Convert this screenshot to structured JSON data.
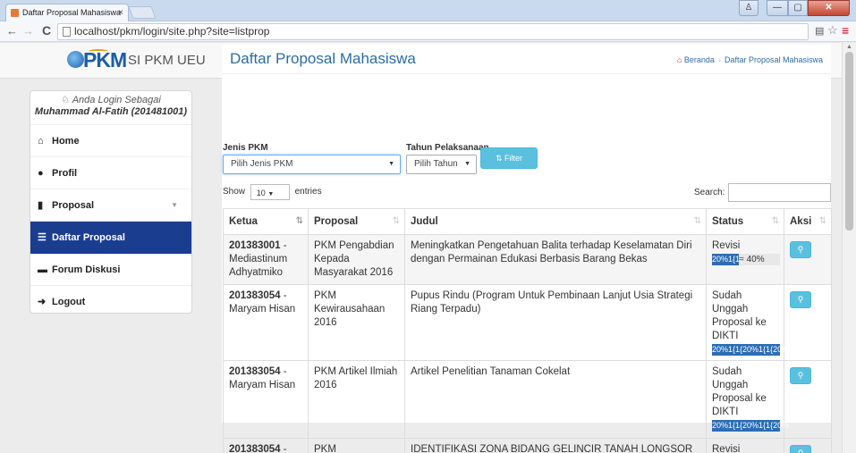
{
  "browser": {
    "tab_title": "Daftar Proposal Mahasiswa",
    "tab_close": "×",
    "url": "localhost/pkm/login/site.php?site=listprop"
  },
  "navbar": {
    "logo_text": "PKM",
    "brand": "SI PKM UEU"
  },
  "sidebar": {
    "login_label": "Anda Login Sebagai",
    "login_name": "Muhammad Al-Fatih (201481001)",
    "items": [
      {
        "label": "Home",
        "icon": "home-icon"
      },
      {
        "label": "Profil",
        "icon": "user-icon"
      },
      {
        "label": "Proposal",
        "icon": "book-icon"
      },
      {
        "label": "Daftar Proposal",
        "icon": "list-icon"
      },
      {
        "label": "Forum Diskusi",
        "icon": "comment-icon"
      },
      {
        "label": "Logout",
        "icon": "logout-icon"
      }
    ]
  },
  "header": {
    "title": "Daftar Proposal Mahasiswa",
    "breadcrumb_home": "Beranda",
    "breadcrumb_current": "Daftar Proposal Mahasiswa"
  },
  "filters": {
    "jenis_label": "Jenis PKM",
    "jenis_value": "Pilih Jenis PKM",
    "tahun_label": "Tahun Pelaksanaan",
    "tahun_value": "Pilih Tahun",
    "filter_button": "Filter"
  },
  "table_controls": {
    "show_label": "Show",
    "entries_value": "10",
    "entries_label": "entries",
    "search_label": "Search:"
  },
  "table": {
    "columns": [
      "Ketua",
      "Proposal",
      "Judul",
      "Status",
      "Aksi"
    ],
    "rows": [
      {
        "ketua_id": "201383001",
        "ketua_name": " - Mediastinum Adhyatmiko",
        "proposal": "PKM Pengabdian Kepada Masyarakat 2016",
        "judul": "Meningkatkan Pengetahuan Balita terhadap Keselamatan Diri dengan Permainan Edukasi Berbasis Barang Bekas",
        "status": "Revisi",
        "progress_text": "20%1{1{",
        "progress_suffix": "= 40%",
        "progress": 0.4
      },
      {
        "ketua_id": "201383054",
        "ketua_name": " - Maryam Hisan",
        "proposal": "PKM Kewirausahaan 2016",
        "judul": "Pupus Rindu (Program Untuk Pembinaan Lanjut Usia Strategi Riang Terpadu)",
        "status": "Sudah Unggah Proposal ke DIKTI",
        "progress_text": "20%1{1{20%1{1{20%",
        "progress_suffix": "",
        "progress": 1.0
      },
      {
        "ketua_id": "201383054",
        "ketua_name": " - Maryam Hisan",
        "proposal": "PKM Artikel Ilmiah 2016",
        "judul": "Artikel Penelitian Tanaman Cokelat",
        "status": "Sudah Unggah Proposal ke DIKTI",
        "progress_text": "20%1{1{20%1{1{20%",
        "progress_suffix": "",
        "progress": 1.0
      },
      {
        "ketua_id": "201383054",
        "ketua_name": " -",
        "proposal": "PKM",
        "judul": "IDENTIFIKASI ZONA BIDANG GELINCIR TANAH LONGSOR DI",
        "status": "Revisi",
        "progress_text": "",
        "progress_suffix": "",
        "progress": 0
      }
    ]
  },
  "colors": {
    "primary": "#2d6ca2",
    "sidebar_active": "#1a3d8f",
    "info_button": "#5bc0de",
    "progress_fill": "#2c6db5"
  }
}
